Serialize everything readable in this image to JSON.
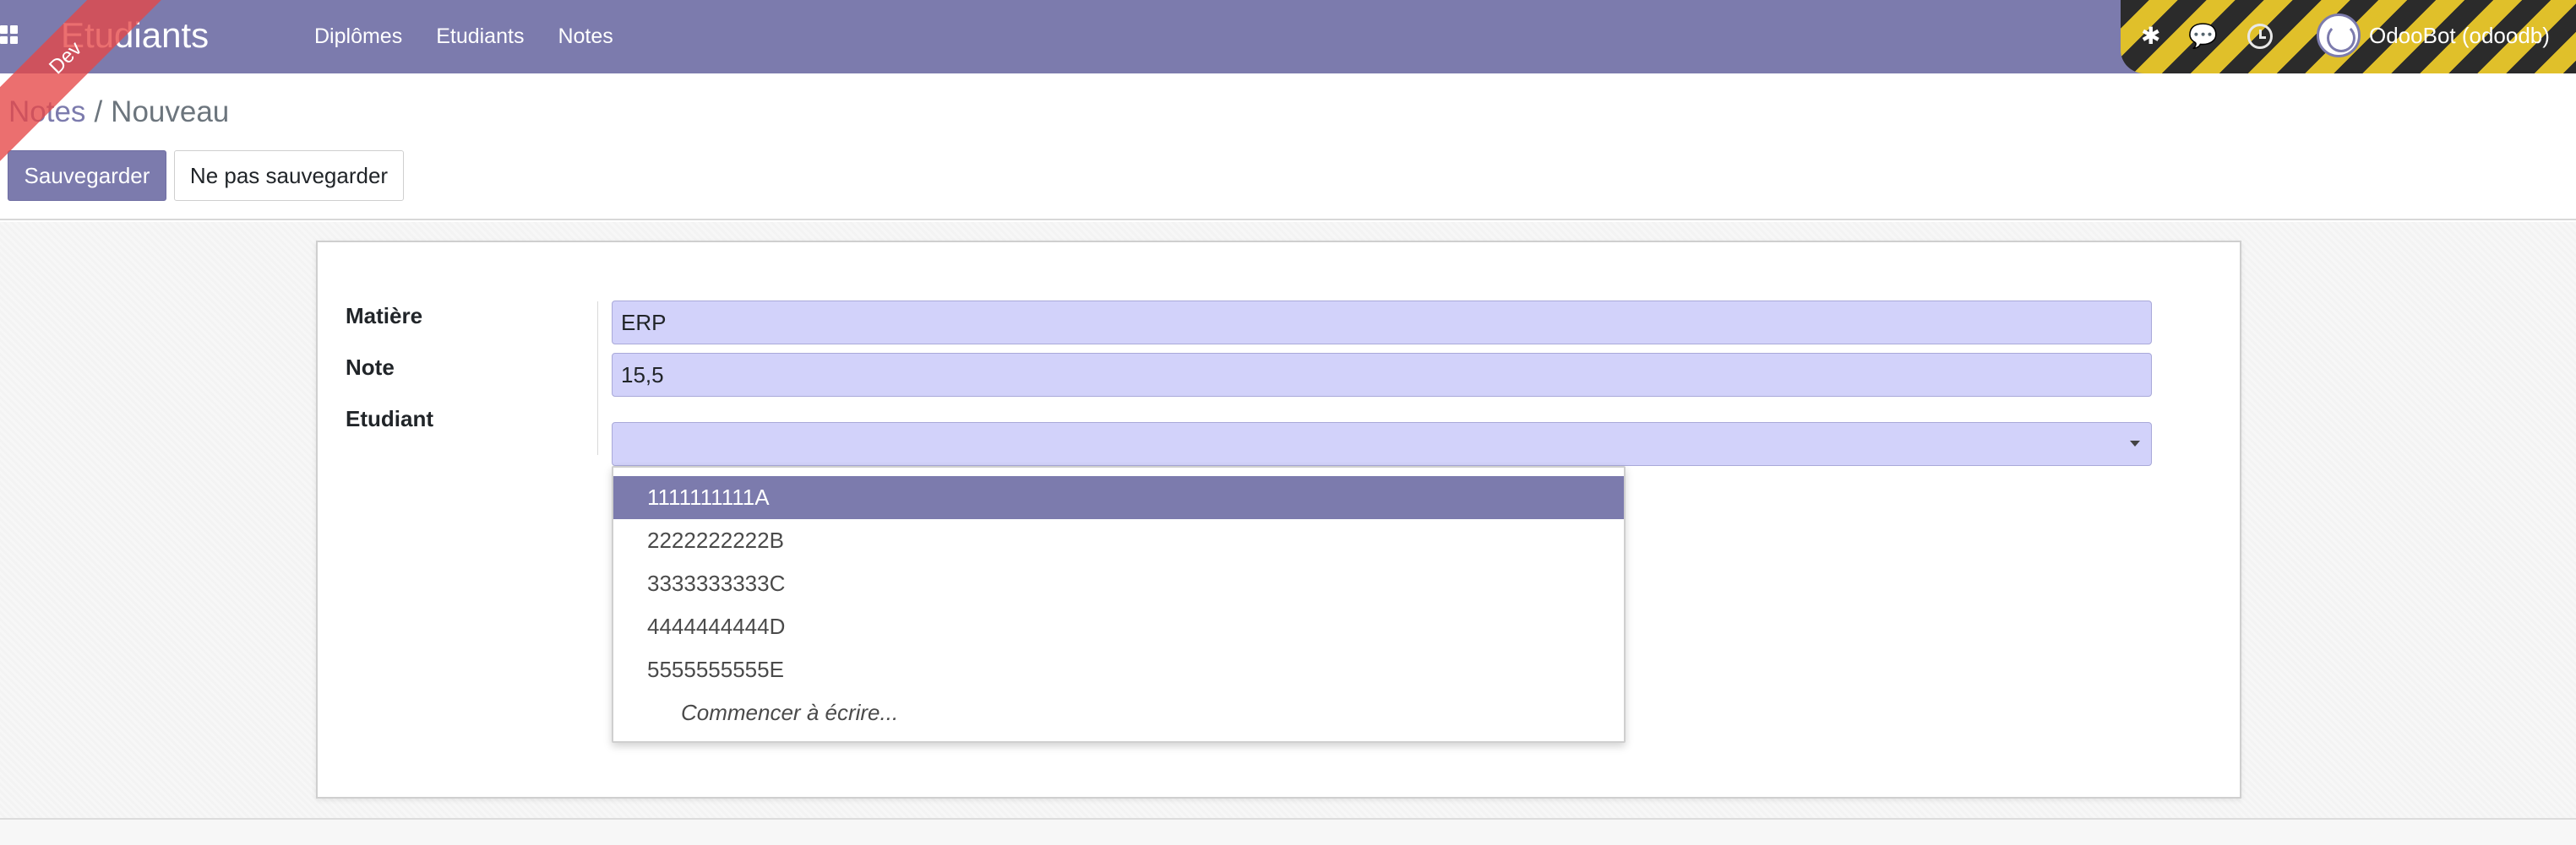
{
  "navbar": {
    "app_title": "Etudiants",
    "ribbon": "Dev",
    "menu": [
      {
        "label": "Diplômes"
      },
      {
        "label": "Etudiants"
      },
      {
        "label": "Notes"
      }
    ],
    "user_name": "OdooBot (odoodb)",
    "brand_color": "#7c7bad"
  },
  "breadcrumb": {
    "parent": "Notes",
    "separator": "/",
    "current": "Nouveau"
  },
  "buttons": {
    "save": "Sauvegarder",
    "discard": "Ne pas sauvegarder"
  },
  "form": {
    "matiere": {
      "label": "Matière",
      "value": "ERP"
    },
    "note": {
      "label": "Note",
      "value": "15,5"
    },
    "etudiant": {
      "label": "Etudiant",
      "value": ""
    }
  },
  "dropdown": {
    "options": [
      {
        "label": "1111111111A",
        "active": true
      },
      {
        "label": "2222222222B"
      },
      {
        "label": "3333333333C"
      },
      {
        "label": "4444444444D"
      },
      {
        "label": "5555555555E"
      }
    ],
    "hint": "Commencer à écrire..."
  },
  "icons": [
    "apps-icon",
    "bug-icon",
    "chat-icon",
    "clock-icon",
    "avatar",
    "chevron-down-icon"
  ]
}
